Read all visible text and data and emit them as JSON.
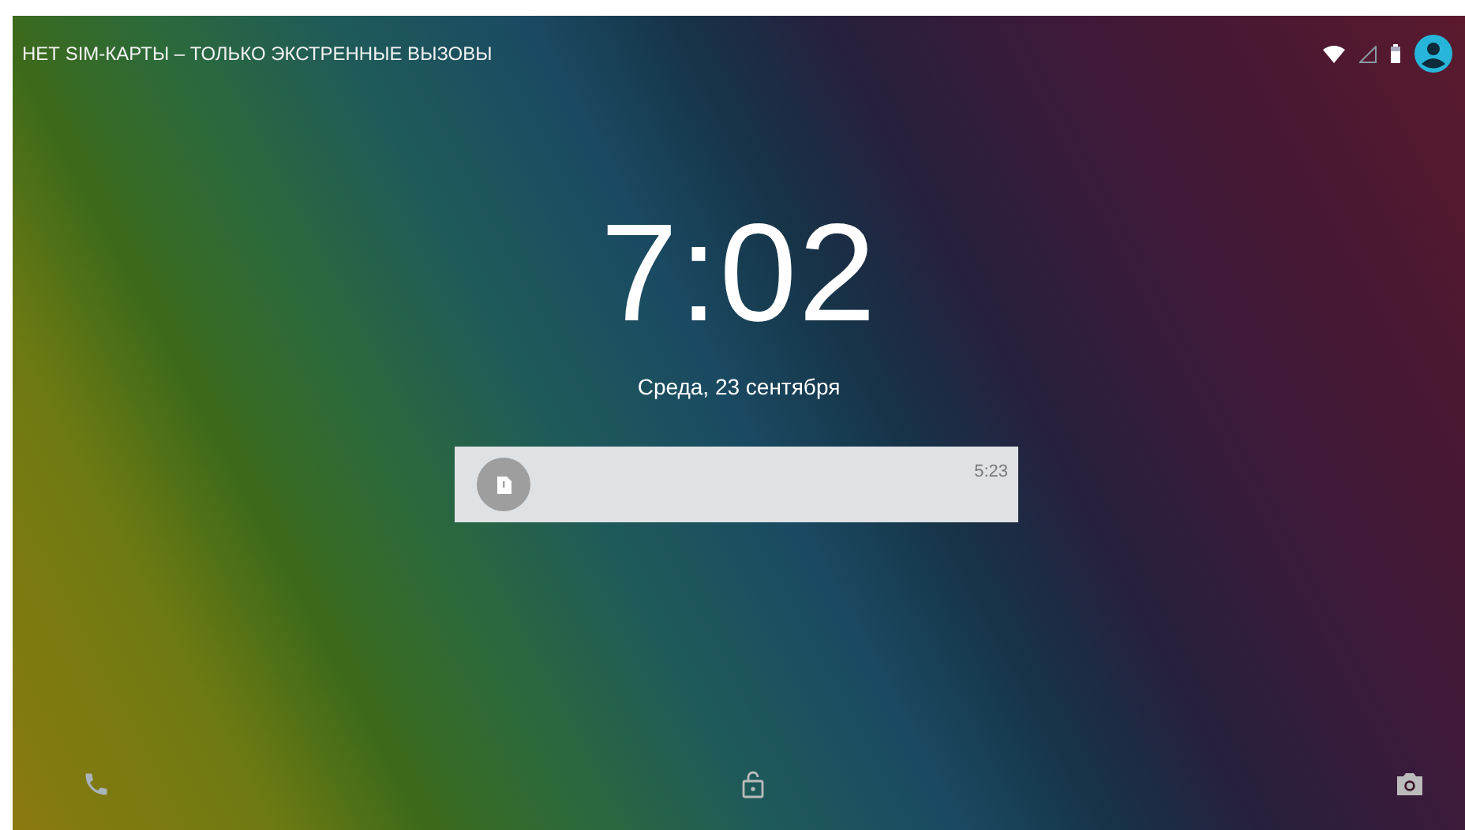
{
  "status_bar": {
    "carrier_text": "НЕТ SIM-КАРТЫ – ТОЛЬКО ЭКСТРЕННЫЕ ВЫЗОВЫ"
  },
  "clock": {
    "time": "7:02",
    "date": "Среда, 23 сентября"
  },
  "notifications": [
    {
      "time": "5:23"
    }
  ]
}
